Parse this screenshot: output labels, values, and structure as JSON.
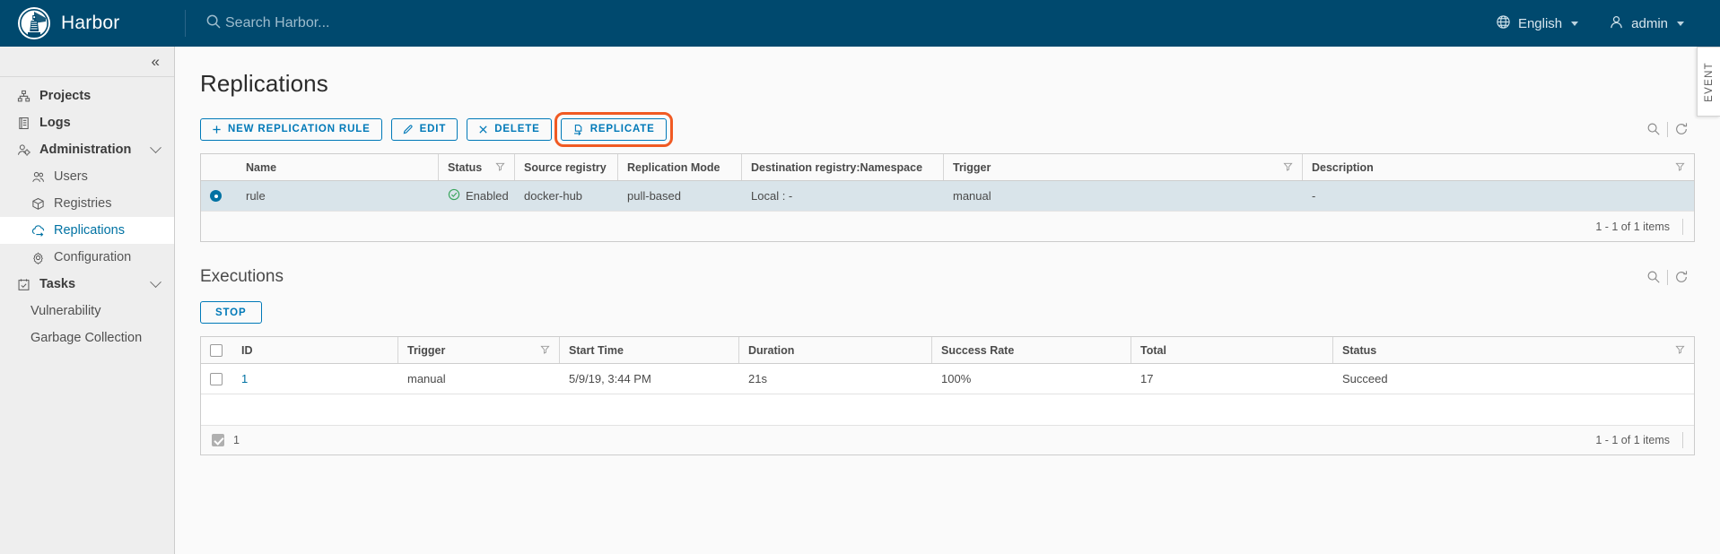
{
  "header": {
    "brand": "Harbor",
    "search_placeholder": "Search Harbor...",
    "language": "English",
    "user": "admin"
  },
  "sidebar": {
    "collapse_label": "«",
    "items": [
      {
        "label": "Projects",
        "icon": "projects-icon",
        "level": "top",
        "expandable": false,
        "active": false
      },
      {
        "label": "Logs",
        "icon": "logs-icon",
        "level": "top",
        "expandable": false,
        "active": false
      },
      {
        "label": "Administration",
        "icon": "administration-icon",
        "level": "top",
        "expandable": true,
        "active": false
      },
      {
        "label": "Users",
        "icon": "users-icon",
        "level": "sub",
        "expandable": false,
        "active": false
      },
      {
        "label": "Registries",
        "icon": "registries-icon",
        "level": "sub",
        "expandable": false,
        "active": false
      },
      {
        "label": "Replications",
        "icon": "replications-icon",
        "level": "sub",
        "expandable": false,
        "active": true
      },
      {
        "label": "Configuration",
        "icon": "configuration-icon",
        "level": "sub",
        "expandable": false,
        "active": false
      },
      {
        "label": "Tasks",
        "icon": "tasks-icon",
        "level": "top",
        "expandable": true,
        "active": false
      },
      {
        "label": "Vulnerability",
        "icon": "",
        "level": "plain",
        "expandable": false,
        "active": false
      },
      {
        "label": "Garbage Collection",
        "icon": "",
        "level": "plain",
        "expandable": false,
        "active": false
      }
    ]
  },
  "page": {
    "title": "Replications",
    "buttons": {
      "new_rule": "NEW REPLICATION RULE",
      "edit": "EDIT",
      "delete": "DELETE",
      "replicate": "REPLICATE"
    },
    "highlight_color": "#f05a23"
  },
  "replications_table": {
    "columns": [
      {
        "label": "Name",
        "filter": false
      },
      {
        "label": "Status",
        "filter": true
      },
      {
        "label": "Source registry",
        "filter": false
      },
      {
        "label": "Replication Mode",
        "filter": false
      },
      {
        "label": "Destination registry:Namespace",
        "filter": false
      },
      {
        "label": "Trigger",
        "filter": true
      },
      {
        "label": "Description",
        "filter": true
      }
    ],
    "rows": [
      {
        "selected": true,
        "name": "rule",
        "status": "Enabled",
        "source_registry": "docker-hub",
        "replication_mode": "pull-based",
        "destination": "Local : -",
        "trigger": "manual",
        "description": "-"
      }
    ],
    "footer_count": "1 - 1 of 1 items"
  },
  "executions": {
    "title": "Executions",
    "stop_label": "STOP",
    "columns": [
      {
        "label": "ID",
        "filter": false
      },
      {
        "label": "Trigger",
        "filter": true
      },
      {
        "label": "Start Time",
        "filter": false
      },
      {
        "label": "Duration",
        "filter": false
      },
      {
        "label": "Success Rate",
        "filter": false
      },
      {
        "label": "Total",
        "filter": false
      },
      {
        "label": "Status",
        "filter": true
      }
    ],
    "rows": [
      {
        "checked": false,
        "id": "1",
        "trigger": "manual",
        "start_time": "5/9/19, 3:44 PM",
        "duration": "21s",
        "success_rate": "100%",
        "total": "17",
        "status": "Succeed"
      }
    ],
    "footer_selected_count": "1",
    "footer_count": "1 - 1 of 1 items"
  },
  "event_tab": {
    "label": "EVENT"
  }
}
